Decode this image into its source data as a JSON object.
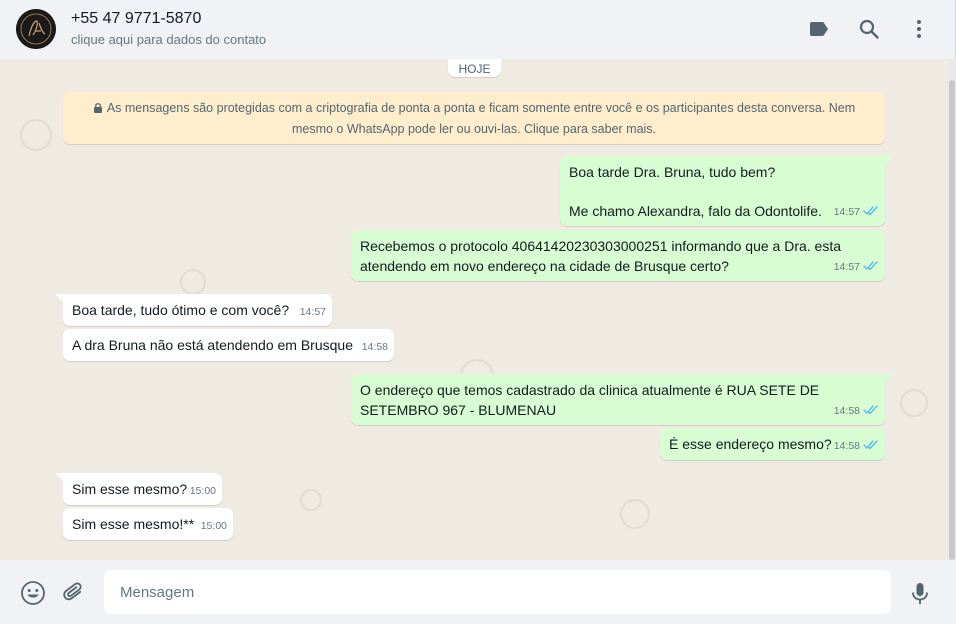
{
  "header": {
    "contact_name": "+55 47 9771-5870",
    "contact_subtitle": "clique aqui para dados do contato",
    "icons": [
      "label-icon",
      "search-icon",
      "menu-icon"
    ]
  },
  "chat": {
    "date_label": "HOJE",
    "encryption_notice": "As mensagens são protegidas com a criptografia de ponta a ponta e ficam somente entre você e os participantes desta conversa. Nem mesmo o WhatsApp pode ler ou ouvi-las. Clique para saber mais.",
    "messages": [
      {
        "direction": "out",
        "line1": "Boa tarde Dra. Bruna, tudo bem?",
        "line2": "Me chamo Alexandra, falo da Odontolife.",
        "time": "14:57",
        "status": "read"
      },
      {
        "direction": "out",
        "text": "Recebemos o protocolo 40641420230303000251 informando que a Dra. esta atendendo em novo endereço na cidade de Brusque certo?",
        "time": "14:57",
        "status": "read"
      },
      {
        "direction": "in",
        "text": "Boa tarde, tudo ótimo e com você?",
        "time": "14:57"
      },
      {
        "direction": "in",
        "text": "A dra Bruna não está atendendo em Brusque",
        "time": "14:58"
      },
      {
        "direction": "out",
        "text": "O endereço que temos cadastrado da clinica atualmente é RUA SETE DE SETEMBRO  967 - BLUMENAU",
        "time": "14:58",
        "status": "read"
      },
      {
        "direction": "out",
        "text": "É esse endereço mesmo?",
        "time": "14:58",
        "status": "read"
      },
      {
        "direction": "in",
        "text": "Sim esse mesmo?",
        "time": "15:00"
      },
      {
        "direction": "in",
        "text": "Sim esse mesmo!**",
        "time": "15:00"
      }
    ]
  },
  "footer": {
    "input_placeholder": "Mensagem",
    "icons": [
      "emoji-icon",
      "attach-icon",
      "microphone-icon"
    ]
  },
  "colors": {
    "outgoing_bubble": "#d9fdd3",
    "incoming_bubble": "#ffffff",
    "chat_background": "#efeae2",
    "encryption_banner": "#ffeecd",
    "read_ticks": "#53bdeb"
  }
}
